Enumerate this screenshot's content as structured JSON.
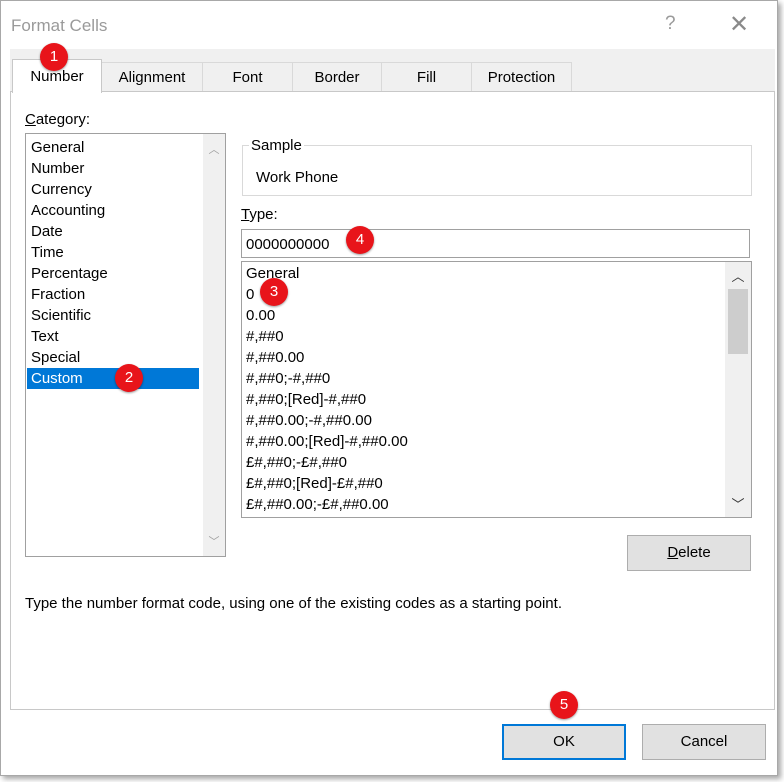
{
  "window": {
    "title": "Format Cells",
    "help": "?",
    "close": "✕"
  },
  "tabs": [
    {
      "label": "Number"
    },
    {
      "label": "Alignment"
    },
    {
      "label": "Font"
    },
    {
      "label": "Border"
    },
    {
      "label": "Fill"
    },
    {
      "label": "Protection"
    }
  ],
  "category": {
    "label": "Category:",
    "items": [
      "General",
      "Number",
      "Currency",
      "Accounting",
      "Date",
      "Time",
      "Percentage",
      "Fraction",
      "Scientific",
      "Text",
      "Special",
      "Custom"
    ],
    "selected": "Custom"
  },
  "sample": {
    "label": "Sample",
    "value": "Work Phone"
  },
  "type": {
    "label": "Type:",
    "value": "0000000000",
    "formats": [
      "General",
      "0",
      "0.00",
      "#,##0",
      "#,##0.00",
      "#,##0;-#,##0",
      "#,##0;[Red]-#,##0",
      "#,##0.00;-#,##0.00",
      "#,##0.00;[Red]-#,##0.00",
      "£#,##0;-£#,##0",
      "£#,##0;[Red]-£#,##0",
      "£#,##0.00;-£#,##0.00"
    ]
  },
  "buttons": {
    "delete": "Delete",
    "ok": "OK",
    "cancel": "Cancel"
  },
  "hint": "Type the number format code, using one of the existing codes as a starting point.",
  "badges": [
    "1",
    "2",
    "3",
    "4",
    "5"
  ],
  "colors": {
    "selection": "#0078d7",
    "badge": "#e8141a",
    "dialog_bg": "#f0f0f0"
  }
}
